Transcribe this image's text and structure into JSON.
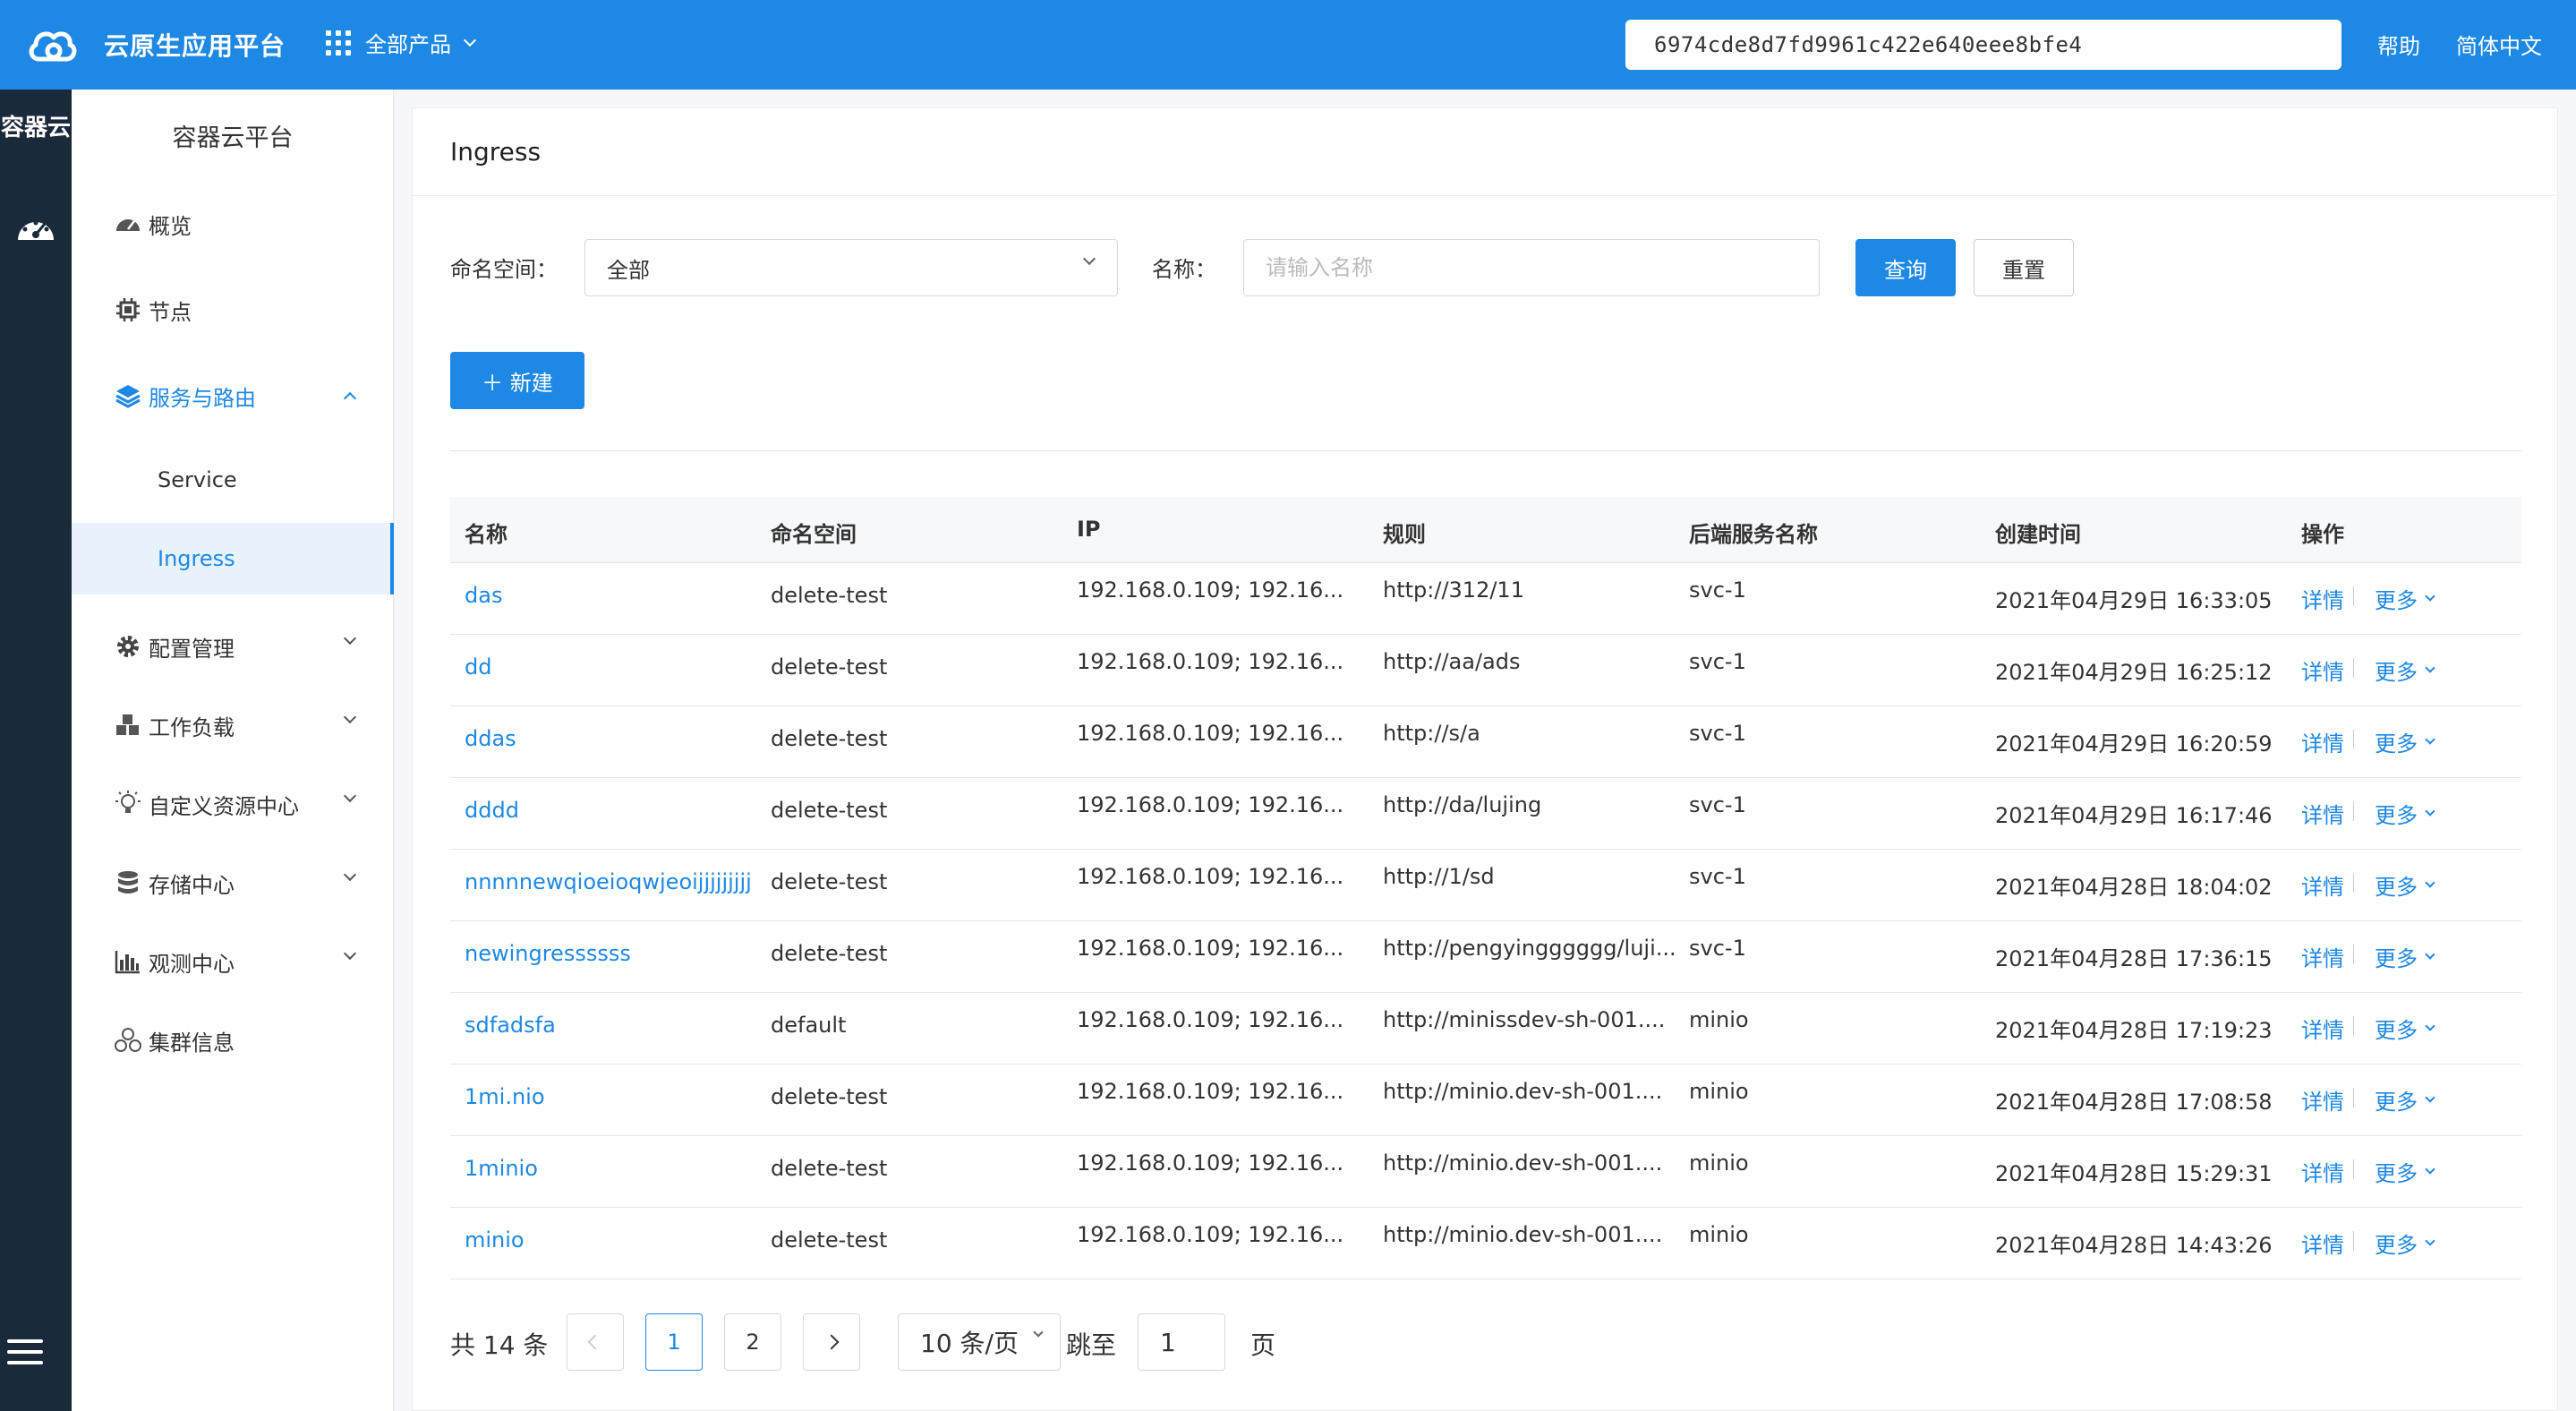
{
  "header": {
    "brand": "云原生应用平台",
    "all_products": "全部产品",
    "token": "6974cde8d7fd9961c422e640eee8bfe4",
    "help": "帮助",
    "language": "简体中文"
  },
  "rail": {
    "title": "容器云"
  },
  "sidebar": {
    "title": "容器云平台",
    "items": [
      {
        "label": "概览"
      },
      {
        "label": "节点"
      },
      {
        "label": "服务与路由"
      },
      {
        "label": "配置管理"
      },
      {
        "label": "工作负载"
      },
      {
        "label": "自定义资源中心"
      },
      {
        "label": "存储中心"
      },
      {
        "label": "观测中心"
      },
      {
        "label": "集群信息"
      }
    ],
    "sub_items": [
      {
        "label": "Service"
      },
      {
        "label": "Ingress"
      }
    ]
  },
  "page": {
    "title": "Ingress",
    "filter": {
      "namespace_label": "命名空间：",
      "namespace_value": "全部",
      "name_label": "名称：",
      "name_placeholder": "请输入名称",
      "query_button": "查询",
      "reset_button": "重置"
    },
    "new_button": "＋  新建"
  },
  "table": {
    "columns": [
      "名称",
      "命名空间",
      "IP",
      "规则",
      "后端服务名称",
      "创建时间",
      "操作"
    ],
    "detail_label": "详情",
    "more_label": "更多",
    "rows": [
      {
        "name": "das",
        "namespace": "delete-test",
        "ip": "192.168.0.109; 192.16...",
        "rule": "http://312/11",
        "service": "svc-1",
        "created": "2021年04月29日 16:33:05"
      },
      {
        "name": "dd",
        "namespace": "delete-test",
        "ip": "192.168.0.109; 192.16...",
        "rule": "http://aa/ads",
        "service": "svc-1",
        "created": "2021年04月29日 16:25:12"
      },
      {
        "name": "ddas",
        "namespace": "delete-test",
        "ip": "192.168.0.109; 192.16...",
        "rule": "http://s/a",
        "service": "svc-1",
        "created": "2021年04月29日 16:20:59"
      },
      {
        "name": "dddd",
        "namespace": "delete-test",
        "ip": "192.168.0.109; 192.16...",
        "rule": "http://da/lujing",
        "service": "svc-1",
        "created": "2021年04月29日 16:17:46"
      },
      {
        "name": "nnnnnewqioeioqwjeoijjjjjjjjj",
        "namespace": "delete-test",
        "ip": "192.168.0.109; 192.16...",
        "rule": "http://1/sd",
        "service": "svc-1",
        "created": "2021年04月28日 18:04:02"
      },
      {
        "name": "newingressssss",
        "namespace": "delete-test",
        "ip": "192.168.0.109; 192.16...",
        "rule": "http://pengyingggggg/luji...",
        "service": "svc-1",
        "created": "2021年04月28日 17:36:15"
      },
      {
        "name": "sdfadsfa",
        "namespace": "default",
        "ip": "192.168.0.109; 192.16...",
        "rule": "http://minissdev-sh-001....",
        "service": "minio",
        "created": "2021年04月28日 17:19:23"
      },
      {
        "name": "1mi.nio",
        "namespace": "delete-test",
        "ip": "192.168.0.109; 192.16...",
        "rule": "http://minio.dev-sh-001....",
        "service": "minio",
        "created": "2021年04月28日 17:08:58"
      },
      {
        "name": "1minio",
        "namespace": "delete-test",
        "ip": "192.168.0.109; 192.16...",
        "rule": "http://minio.dev-sh-001....",
        "service": "minio",
        "created": "2021年04月28日 15:29:31"
      },
      {
        "name": "minio",
        "namespace": "delete-test",
        "ip": "192.168.0.109; 192.16...",
        "rule": "http://minio.dev-sh-001....",
        "service": "minio",
        "created": "2021年04月28日 14:43:26"
      }
    ]
  },
  "pagination": {
    "total": "共 14 条",
    "pages": [
      "1",
      "2"
    ],
    "current": "1",
    "page_size": "10 条/页",
    "jump_label": "跳至",
    "jump_value": "1",
    "page_unit": "页"
  },
  "colors": {
    "primary": "#1e88e5",
    "rail_bg": "#1b2a3a"
  }
}
